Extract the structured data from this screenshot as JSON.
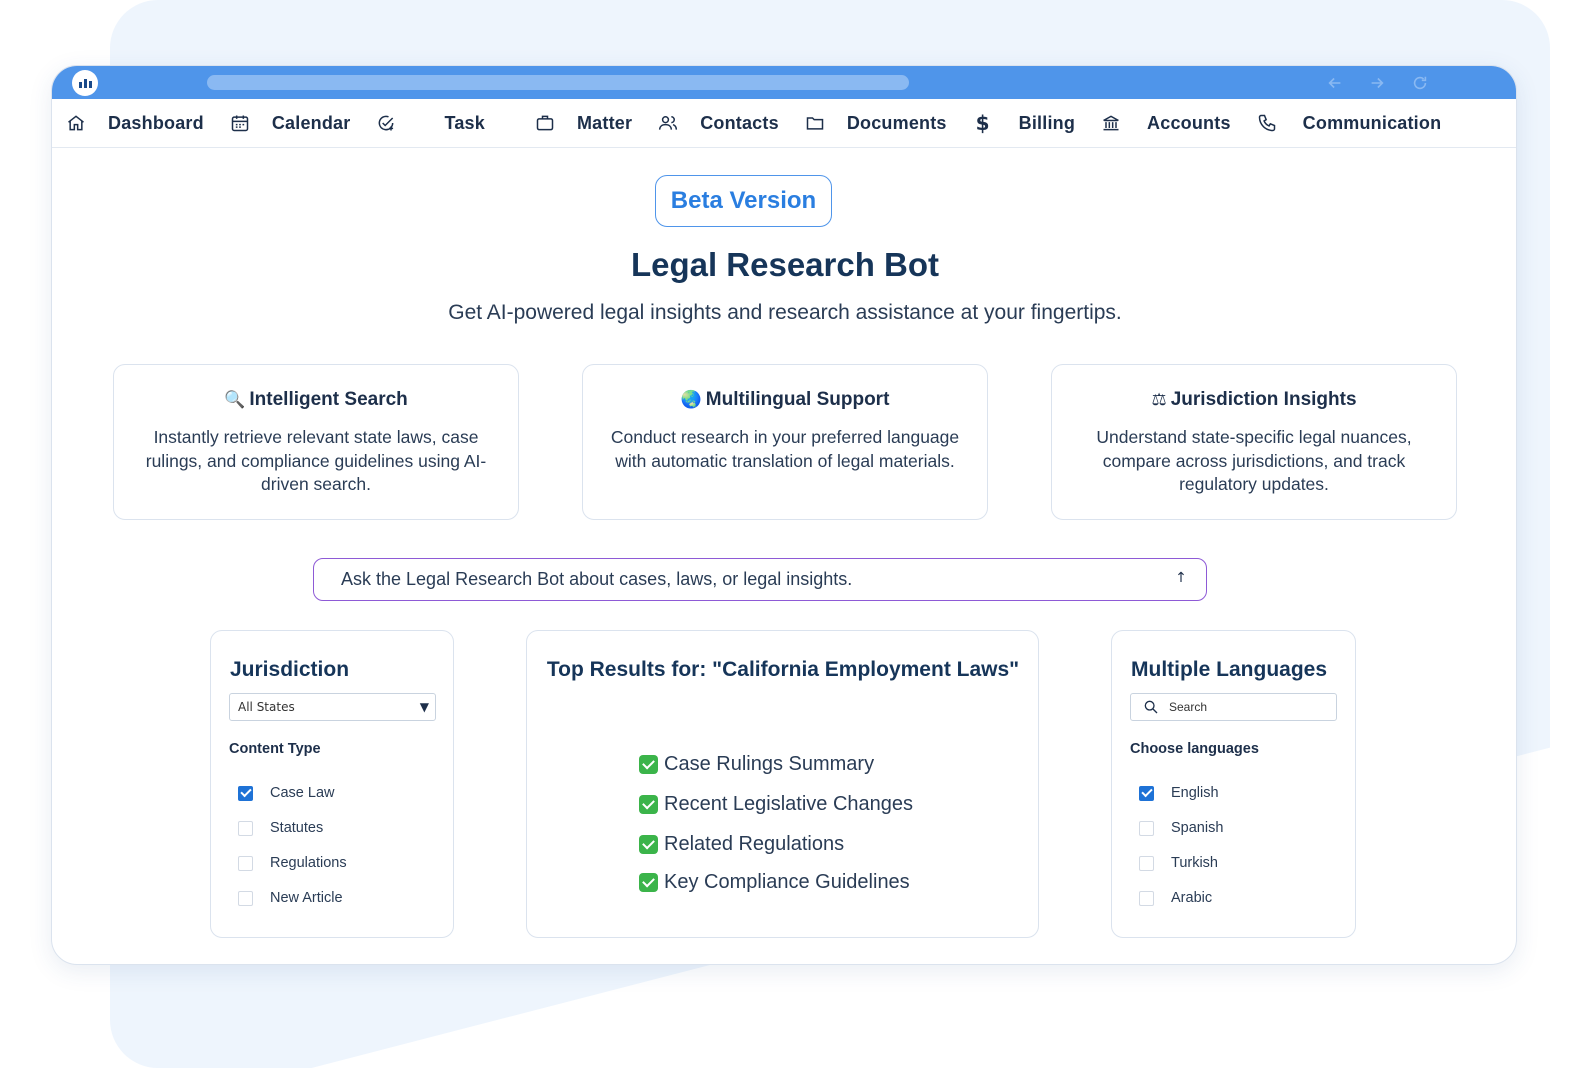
{
  "nav": {
    "items": [
      {
        "label": "Dashboard",
        "icon": "home-icon"
      },
      {
        "label": "Calendar",
        "icon": "calendar-icon"
      },
      {
        "label": "Task",
        "icon": "task-check-icon"
      },
      {
        "label": "Matter",
        "icon": "briefcase-icon"
      },
      {
        "label": "Contacts",
        "icon": "contacts-icon"
      },
      {
        "label": "Documents",
        "icon": "folder-icon"
      },
      {
        "label": "Billing",
        "icon": "dollar-icon"
      },
      {
        "label": "Accounts",
        "icon": "bank-icon"
      },
      {
        "label": "Communication",
        "icon": "phone-icon"
      }
    ]
  },
  "hero": {
    "badge": "Beta Version",
    "title": "Legal Research Bot",
    "subtitle": "Get AI-powered legal insights and research assistance at your fingertips."
  },
  "features": [
    {
      "icon": "magnifier-emoji",
      "emoji": "🔍",
      "title": "Intelligent Search",
      "description": "Instantly retrieve relevant state laws, case rulings, and compliance guidelines using AI-driven search."
    },
    {
      "icon": "globe-emoji",
      "emoji": "🌏",
      "title": "Multilingual Support",
      "description": "Conduct research in your preferred language with automatic translation of legal materials."
    },
    {
      "icon": "scales-emoji",
      "emoji": "⚖",
      "title": "Jurisdiction Insights",
      "description": "Understand state-specific legal nuances, compare across jurisdictions, and track regulatory updates."
    }
  ],
  "chat": {
    "placeholder": "Ask the Legal Research Bot about cases, laws, or legal insights.",
    "send_icon": "↑"
  },
  "jurisdiction": {
    "title": "Jurisdiction",
    "select_value": "All States",
    "content_type_label": "Content Type",
    "options": [
      {
        "label": "Case Law",
        "checked": true
      },
      {
        "label": "Statutes",
        "checked": false
      },
      {
        "label": "Regulations",
        "checked": false
      },
      {
        "label": "New Article",
        "checked": false
      }
    ]
  },
  "results": {
    "title": "Top Results for: \"California Employment Laws\"",
    "items": [
      "Case Rulings Summary",
      "Recent Legislative Changes",
      "Related Regulations",
      "Key Compliance Guidelines"
    ]
  },
  "languages": {
    "title": "Multiple Languages",
    "search_placeholder": "Search",
    "choose_label": "Choose languages",
    "options": [
      {
        "label": "English",
        "checked": true
      },
      {
        "label": "Spanish",
        "checked": false
      },
      {
        "label": "Turkish",
        "checked": false
      },
      {
        "label": "Arabic",
        "checked": false
      }
    ]
  },
  "colors": {
    "titlebar": "#4f95ea",
    "accent": "#1e72d6",
    "input_border": "#8e5ad6",
    "success": "#3bb44a"
  }
}
